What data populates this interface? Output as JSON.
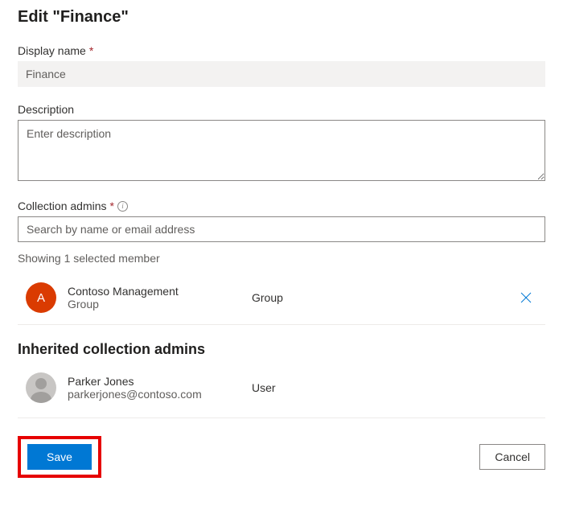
{
  "pageTitle": "Edit \"Finance\"",
  "displayName": {
    "label": "Display name",
    "value": "Finance"
  },
  "description": {
    "label": "Description",
    "placeholder": "Enter description",
    "value": ""
  },
  "collectionAdmins": {
    "label": "Collection admins",
    "searchPlaceholder": "Search by name or email address",
    "showingText": "Showing 1 selected member",
    "members": [
      {
        "initial": "A",
        "name": "Contoso Management",
        "sub": "Group",
        "type": "Group"
      }
    ]
  },
  "inherited": {
    "heading": "Inherited collection admins",
    "members": [
      {
        "name": "Parker Jones",
        "sub": "parkerjones@contoso.com",
        "type": "User"
      }
    ]
  },
  "footer": {
    "save": "Save",
    "cancel": "Cancel"
  }
}
